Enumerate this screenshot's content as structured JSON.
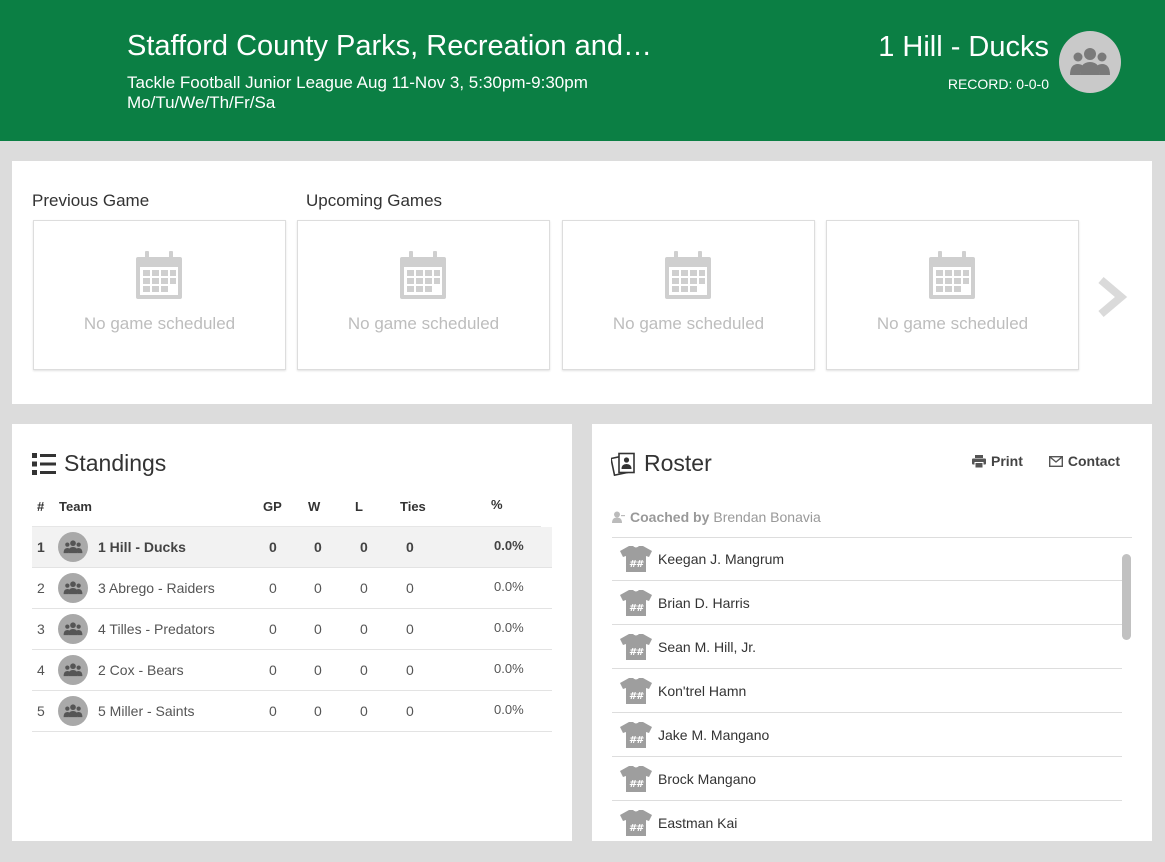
{
  "header": {
    "league_title": "Stafford County Parks, Recreation and…",
    "league_subtitle": "Tackle Football Junior League Aug 11-Nov 3, 5:30pm-9:30pm Mo/Tu/We/Th/Fr/Sa",
    "team_name": "1 Hill - Ducks",
    "record": "RECORD: 0-0-0",
    "avatar_icon": "group-icon"
  },
  "games": {
    "previous_label": "Previous Game",
    "upcoming_label": "Upcoming Games",
    "cards": [
      {
        "text": "No game scheduled",
        "icon": "calendar-icon"
      },
      {
        "text": "No game scheduled",
        "icon": "calendar-icon"
      },
      {
        "text": "No game scheduled",
        "icon": "calendar-icon"
      },
      {
        "text": "No game scheduled",
        "icon": "calendar-icon"
      }
    ],
    "next_icon": "chevron-right-icon"
  },
  "standings": {
    "title": "Standings",
    "columns": {
      "rank": "#",
      "team": "Team",
      "gp": "GP",
      "w": "W",
      "l": "L",
      "ties": "Ties",
      "pct": "%"
    },
    "rows": [
      {
        "rank": "1",
        "team": "1 Hill - Ducks",
        "gp": "0",
        "w": "0",
        "l": "0",
        "ties": "0",
        "pct": "0.0%"
      },
      {
        "rank": "2",
        "team": "3 Abrego - Raiders",
        "gp": "0",
        "w": "0",
        "l": "0",
        "ties": "0",
        "pct": "0.0%"
      },
      {
        "rank": "3",
        "team": "4 Tilles - Predators",
        "gp": "0",
        "w": "0",
        "l": "0",
        "ties": "0",
        "pct": "0.0%"
      },
      {
        "rank": "4",
        "team": "2 Cox - Bears",
        "gp": "0",
        "w": "0",
        "l": "0",
        "ties": "0",
        "pct": "0.0%"
      },
      {
        "rank": "5",
        "team": "5 Miller - Saints",
        "gp": "0",
        "w": "0",
        "l": "0",
        "ties": "0",
        "pct": "0.0%"
      }
    ]
  },
  "roster": {
    "title": "Roster",
    "print_label": "Print",
    "contact_label": "Contact",
    "coached_prefix": "Coached by",
    "coach_name": "Brendan Bonavia",
    "players": [
      "Keegan J. Mangrum",
      "Brian D. Harris",
      "Sean M. Hill, Jr.",
      "Kon'trel Hamn",
      "Jake M. Mangano",
      "Brock Mangano",
      "Eastman Kai"
    ]
  },
  "colors": {
    "header_bg": "#0b7f44",
    "page_bg": "#dcdcdc",
    "muted_text": "#bdbdbd"
  }
}
